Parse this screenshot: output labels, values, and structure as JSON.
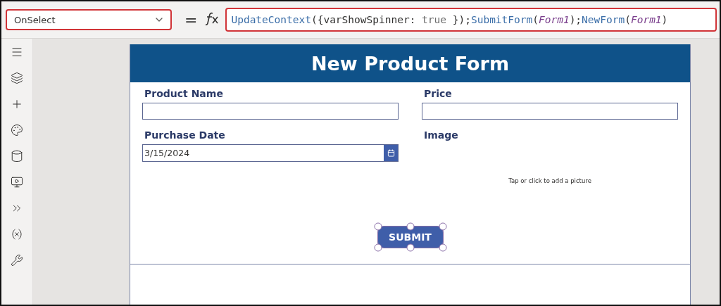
{
  "property_dropdown": {
    "value": "OnSelect",
    "highlighted": true
  },
  "equals": "=",
  "formula": {
    "highlighted": true,
    "tokens": [
      {
        "kind": "func",
        "text": "UpdateContext"
      },
      {
        "kind": "punct",
        "text": "({"
      },
      {
        "kind": "ident",
        "text": "varShowSpinner"
      },
      {
        "kind": "punct",
        "text": ": "
      },
      {
        "kind": "keyword",
        "text": "true"
      },
      {
        "kind": "punct",
        "text": " });"
      },
      {
        "kind": "func",
        "text": "SubmitForm"
      },
      {
        "kind": "punct",
        "text": "("
      },
      {
        "kind": "param",
        "text": "Form1"
      },
      {
        "kind": "punct",
        "text": ");"
      },
      {
        "kind": "func",
        "text": "NewForm"
      },
      {
        "kind": "punct",
        "text": "("
      },
      {
        "kind": "param",
        "text": "Form1"
      },
      {
        "kind": "punct",
        "text": ")"
      }
    ]
  },
  "form": {
    "title": "New Product Form",
    "fields": [
      {
        "kind": "text",
        "label": "Product Name"
      },
      {
        "kind": "text",
        "label": "Price"
      },
      {
        "kind": "date",
        "label": "Purchase Date",
        "value": "3/15/2024"
      },
      {
        "kind": "image",
        "label": "Image",
        "placeholder": "Tap or click to add a picture"
      }
    ],
    "submit": {
      "label": "SUBMIT",
      "selected": true
    }
  }
}
